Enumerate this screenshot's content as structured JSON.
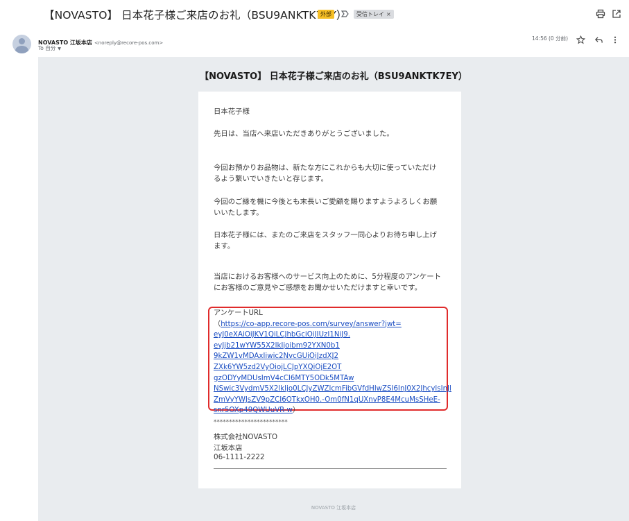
{
  "header": {
    "subject": "【NOVASTO】 日本花子様ご来店のお礼（BSU9ANKTK7EY）",
    "labels": [
      {
        "text": "外部",
        "color": "#f6bf26"
      },
      {
        "text": "受信トレイ",
        "remove": "×",
        "color": "#dadce0"
      }
    ],
    "icons": [
      "importance-marker-icon",
      "print-icon",
      "open-in-new-window-icon"
    ]
  },
  "message": {
    "sender_name": "NOVASTO 江坂本店",
    "sender_email": "<noreply@recore-pos.com>",
    "to": "To 自分",
    "to_caret": "▼",
    "timestamp": "14:56 (0 分前)",
    "icons": [
      "avatar-icon",
      "star-icon",
      "reply-icon",
      "more-vert-icon"
    ]
  },
  "email": {
    "title": "【NOVASTO】 日本花子様ご来店のお礼（BSU9ANKTK7EY）",
    "greeting": "日本花子様",
    "thanks": "先日は、当店へ来店いただきありがとうございました。",
    "item_care": "今回お預かりお品物は、新たな方にこれからも大切に使っていただけるよう繋いでいきたいと存じます。",
    "relation": "今回のご縁を機に今後とも末長いご愛顧を賜りますようよろしくお願いいたします。",
    "wait": "日本花子様には、またのご来店をスタッフ一同心よりお待ち申し上げます。",
    "survey": "当店におけるお客様へのサービス向上のために、5分程度のアンケートにお客様のご意見やご感想をお聞かせいただけますと幸いです。",
    "survey_url_prefix": "アンケートURL（",
    "survey_url_lines": [
      "https://co-app.recore-pos.com/survey/answer?jwt=",
      "eyJ0eXAiOiJKV1QiLCJhbGciOiJIUzI1NiJ9.",
      "eyJjb21wYW55X2lkIjoibm92YXN0b1",
      "9kZW1vMDAxIiwic2NvcGUiOiJzdXJ2",
      "ZXk6YW5zd2VyOiojLCJpYXQiOjE2OT",
      "gzODYyMDUsImV4cCI6MTY5ODk5MTAw",
      "NSwic3VydmV5X2lkIjo0LCJyZWZlcmFibGVfdHlwZSI6InJ0X2JhcylsInJl",
      "ZmVyYWJsZV9pZCI6OTkxOH0.-Om0fN1qUXnvP8E4McuMsSHeE-",
      "snr5OXp49QWUuVR-w"
    ],
    "survey_url_suffix": "）",
    "signature_stars": "************************",
    "company": "株式会社NOVASTO",
    "branch": "江坂本店",
    "phone": "06-1111-2222",
    "footer": "NOVASTO 江坂本店"
  }
}
